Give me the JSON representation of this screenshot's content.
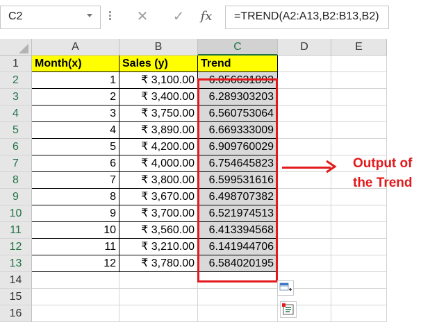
{
  "name_box": {
    "value": "C2"
  },
  "formula_bar": {
    "cancel_icon": "✕",
    "enter_icon": "✓",
    "fx_label": "fx",
    "formula": "=TREND(A2:A13,B2:B13,B2)"
  },
  "columns": [
    "A",
    "B",
    "C",
    "D",
    "E"
  ],
  "rows": [
    "1",
    "2",
    "3",
    "4",
    "5",
    "6",
    "7",
    "8",
    "9",
    "10",
    "11",
    "12",
    "13",
    "14",
    "15",
    "16"
  ],
  "headers": {
    "a": "Month(x)",
    "b": "Sales (y)",
    "c": "Trend"
  },
  "data": [
    {
      "month": "1",
      "sales": "₹ 3,100.00",
      "trend": "6.056631893"
    },
    {
      "month": "2",
      "sales": "₹ 3,400.00",
      "trend": "6.289303203"
    },
    {
      "month": "3",
      "sales": "₹ 3,750.00",
      "trend": "6.560753064"
    },
    {
      "month": "4",
      "sales": "₹ 3,890.00",
      "trend": "6.669333009"
    },
    {
      "month": "5",
      "sales": "₹ 4,200.00",
      "trend": "6.909760029"
    },
    {
      "month": "6",
      "sales": "₹ 4,000.00",
      "trend": "6.754645823"
    },
    {
      "month": "7",
      "sales": "₹ 3,800.00",
      "trend": "6.599531616"
    },
    {
      "month": "8",
      "sales": "₹ 3,670.00",
      "trend": "6.498707382"
    },
    {
      "month": "9",
      "sales": "₹ 3,700.00",
      "trend": "6.521974513"
    },
    {
      "month": "10",
      "sales": "₹ 3,560.00",
      "trend": "6.413394568"
    },
    {
      "month": "11",
      "sales": "₹ 3,210.00",
      "trend": "6.141944706"
    },
    {
      "month": "12",
      "sales": "₹ 3,780.00",
      "trend": "6.584020195"
    }
  ],
  "annotation": {
    "line1": "Output of",
    "line2": "the Trend"
  },
  "colors": {
    "accent": "#e3191b",
    "header_fill": "#ffff00",
    "selected_fill": "#d9d9d9",
    "excel_green": "#217346"
  }
}
